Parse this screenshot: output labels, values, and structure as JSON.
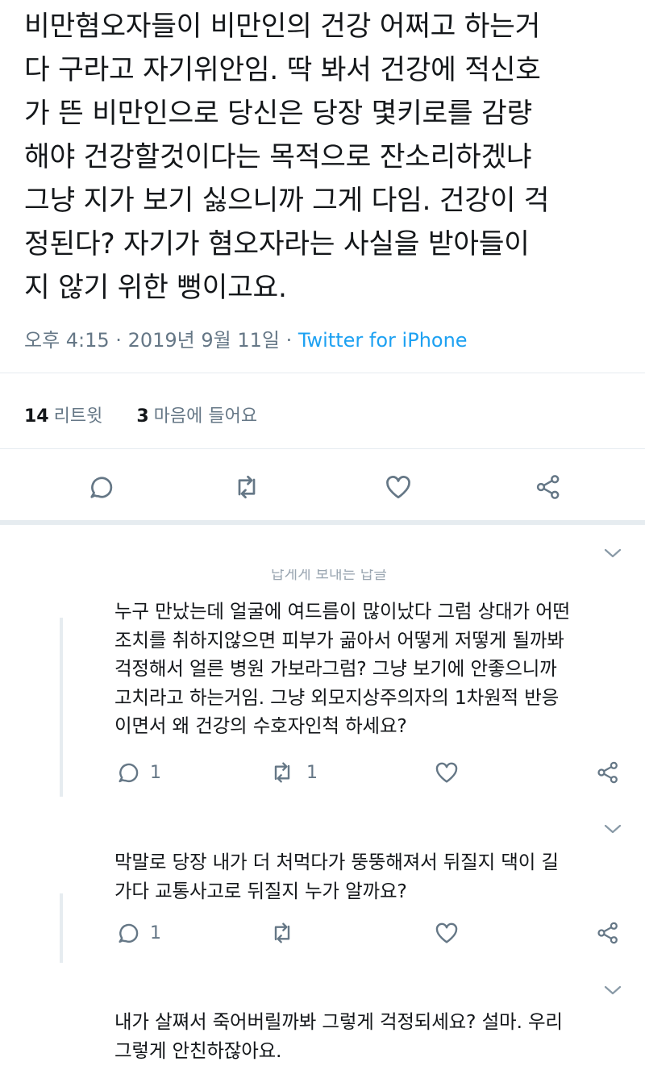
{
  "tweet": {
    "lines": [
      "비만혐오자들이 비만인의 건강 어쩌고 하는거",
      "다 구라고 자기위안임. 딱 봐서 건강에 적신호",
      "가 뜬 비만인으로 당신은 당장 몇키로를 감량",
      "해야 건강할것이다는 목적으로 잔소리하겠냐",
      "그냥 지가 보기 싫으니까 그게 다임. 건강이 걱",
      "정된다? 자기가 혐오자라는 사실을 받아들이",
      "지 않기 위한 뻥이고요."
    ],
    "time": "오후 4:15 · 2019년 9월 11일",
    "separator": " · ",
    "client": "Twitter for iPhone",
    "retweet_count": "14",
    "retweet_label": "리트윗",
    "like_count": "3",
    "like_label": "마음에 들어요"
  },
  "faded_header": "답게게 보내는 답글",
  "replies": [
    {
      "lines": [
        "누구 만났는데 얼굴에 여드름이 많이났다 그럼 상대가 어떤",
        "조치를 취하지않으면 피부가 곪아서 어떻게 저떻게 될까봐",
        "걱정해서 얼른 병원 가보라그럼? 그냥 보기에 안좋으니까",
        "고치라고 하는거임. 그냥 외모지상주의자의 1차원적 반응",
        "이면서 왜 건강의 수호자인척 하세요?"
      ],
      "reply_count": "1",
      "retweet_count": "1"
    },
    {
      "lines": [
        "막말로 당장 내가 더 처먹다가 뚱뚱해져서 뒤질지 댁이 길",
        "가다 교통사고로 뒤질지 누가 알까요?"
      ],
      "reply_count": "1",
      "retweet_count": ""
    },
    {
      "lines": [
        "내가 살쪄서 죽어버릴까봐 그렇게 걱정되세요? 설마. 우리",
        "그렇게 안친하잖아요."
      ]
    }
  ],
  "icons": {
    "reply": "reply-icon",
    "retweet": "retweet-icon",
    "like": "heart-icon",
    "share": "share-icon",
    "more": "chevron-down-icon"
  },
  "colors": {
    "text": "#14171a",
    "secondary": "#657786",
    "link": "#1da1f2",
    "divider": "#e6ecf0"
  }
}
